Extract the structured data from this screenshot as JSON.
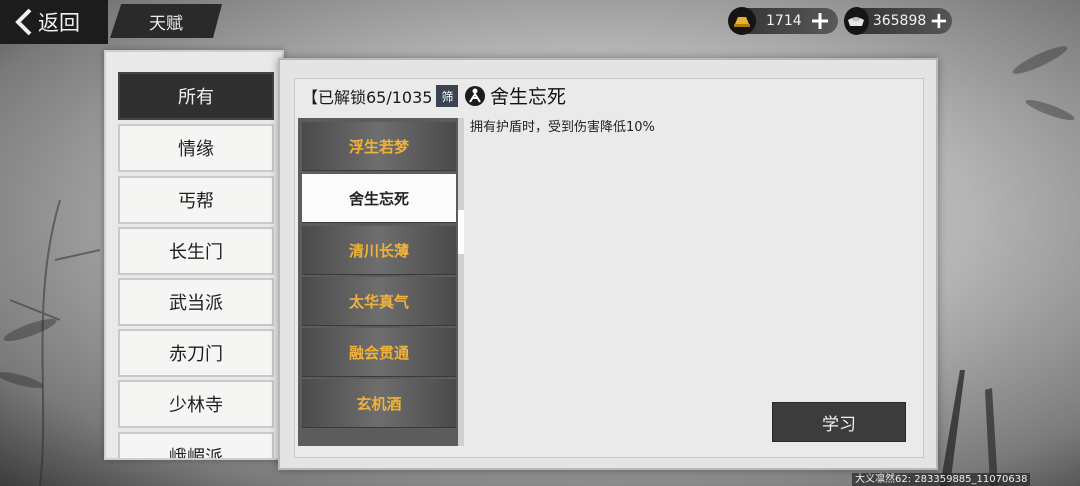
{
  "topbar": {
    "back_label": "返回",
    "title": "天赋",
    "gold": {
      "icon": "gold-ingot-icon",
      "value": "1714"
    },
    "silver": {
      "icon": "silver-ingot-icon",
      "value": "365898"
    }
  },
  "categories": [
    {
      "label": "所有",
      "active": true
    },
    {
      "label": "情缘",
      "active": false
    },
    {
      "label": "丐帮",
      "active": false
    },
    {
      "label": "长生门",
      "active": false
    },
    {
      "label": "武当派",
      "active": false
    },
    {
      "label": "赤刀门",
      "active": false
    },
    {
      "label": "少林寺",
      "active": false
    },
    {
      "label": "峨嵋派",
      "active": false
    }
  ],
  "main": {
    "unlock_text": "【已解锁65/1035",
    "filter_badge": "筛",
    "selected_talent": {
      "icon": "talent-emblem-icon",
      "name": "舍生忘死",
      "description": "拥有护盾时，受到伤害降低10%"
    },
    "talents": [
      {
        "label": "浮生若梦",
        "selected": false
      },
      {
        "label": "舍生忘死",
        "selected": true
      },
      {
        "label": "清川长薄",
        "selected": false
      },
      {
        "label": "太华真气",
        "selected": false
      },
      {
        "label": "融会贯通",
        "selected": false
      },
      {
        "label": "玄机酒",
        "selected": false
      }
    ],
    "learn_label": "学习"
  },
  "footer": {
    "player_info": "大义凛然62: 283359885_11070638"
  },
  "colors": {
    "talent_text": "#f0b23a",
    "dark": "#303030",
    "panel": "#e4e4e2"
  }
}
